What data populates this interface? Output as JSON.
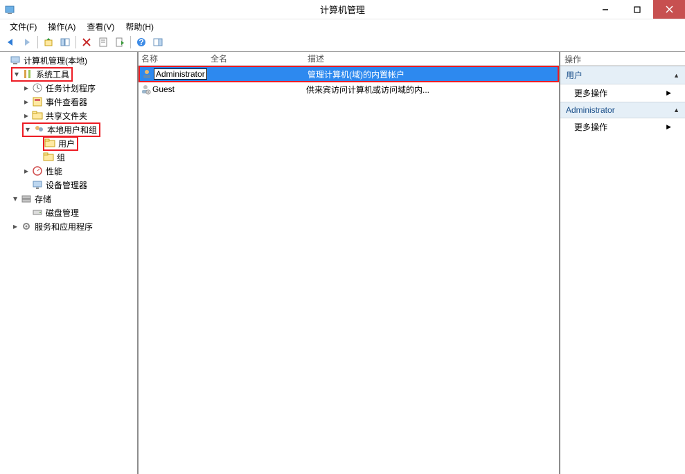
{
  "window": {
    "title": "计算机管理"
  },
  "menus": {
    "file": "文件(F)",
    "action": "操作(A)",
    "view": "查看(V)",
    "help": "帮助(H)"
  },
  "tree": {
    "root": "计算机管理(本地)",
    "system_tools": "系统工具",
    "task_scheduler": "任务计划程序",
    "event_viewer": "事件查看器",
    "shared_folders": "共享文件夹",
    "local_users_groups": "本地用户和组",
    "users": "用户",
    "groups": "组",
    "performance": "性能",
    "device_manager": "设备管理器",
    "storage": "存储",
    "disk_management": "磁盘管理",
    "services_apps": "服务和应用程序"
  },
  "list": {
    "columns": {
      "name": "名称",
      "fullname": "全名",
      "description": "描述"
    },
    "rows": [
      {
        "name": "Administrator",
        "fullname": "",
        "description": "管理计算机(域)的内置帐户",
        "selected": true,
        "rename": true
      },
      {
        "name": "Guest",
        "fullname": "",
        "description": "供来宾访问计算机或访问域的内...",
        "selected": false
      }
    ]
  },
  "actions": {
    "header": "操作",
    "section1_title": "用户",
    "section1_more": "更多操作",
    "section2_title": "Administrator",
    "section2_more": "更多操作"
  }
}
